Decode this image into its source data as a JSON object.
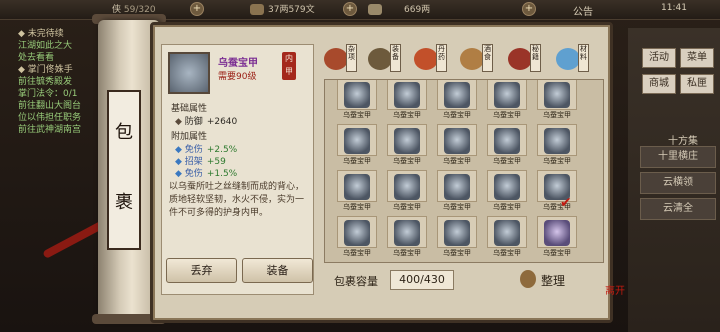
{
  "topbar": {
    "res1_label": "侠",
    "res1_value": "59/320",
    "res2_value": "37两579文",
    "res3_value": "669两",
    "notice": "公告",
    "time": "11:41"
  },
  "quests": [
    {
      "title": "◆ 未完待续",
      "desc": [
        "江湖如此之大",
        "处去看看"
      ]
    },
    {
      "title": "◆ 掌门佟姝手",
      "desc": [
        "前往毓秀殿发",
        "掌门法令：0/1",
        "前往翻山大阁台",
        "位以伟担任职务",
        "前往武神湖南宫"
      ]
    }
  ],
  "side": {
    "buttons": [
      "活动",
      "菜单",
      "商城",
      "私匣"
    ],
    "tag": "十方集",
    "list": [
      "十里横庄",
      "云横领",
      "云清全"
    ]
  },
  "scroll": {
    "chars": [
      "包",
      "裹"
    ]
  },
  "item": {
    "name": "乌蚕宝甲",
    "requirement": "需要90级",
    "seal": "内甲",
    "base_title": "基础属性",
    "base_attrs": [
      {
        "key": "防御",
        "value": "+2640"
      }
    ],
    "extra_title": "附加属性",
    "extra_attrs": [
      {
        "key": "免伤",
        "value": "+2.5%"
      },
      {
        "key": "招架",
        "value": "+59"
      },
      {
        "key": "免伤",
        "value": "+1.5%"
      }
    ],
    "description": "以乌蚕所吐之丝缝制而成的背心，质地轻软坚韧，水火不侵，实为一件不可多得的护身内甲。",
    "discard": "丢弃",
    "equip": "装备"
  },
  "categories": [
    {
      "label": "杂项",
      "color": "#a84a2c"
    },
    {
      "label": "装备",
      "color": "#6d5a3c"
    },
    {
      "label": "丹药",
      "color": "#c2502a"
    },
    {
      "label": "酒食",
      "color": "#b07e44"
    },
    {
      "label": "秘籍",
      "color": "#9a3428"
    },
    {
      "label": "材料",
      "color": "#5fa0d0"
    }
  ],
  "grid": {
    "rows": 5,
    "cols": 5,
    "filled": 22,
    "item_label": "乌蚕宝甲",
    "purple_index": 19,
    "checked_index": 19
  },
  "capacity": {
    "label": "包裹容量",
    "value": "400/430"
  },
  "tidy": "整理",
  "red_mark": "离开"
}
